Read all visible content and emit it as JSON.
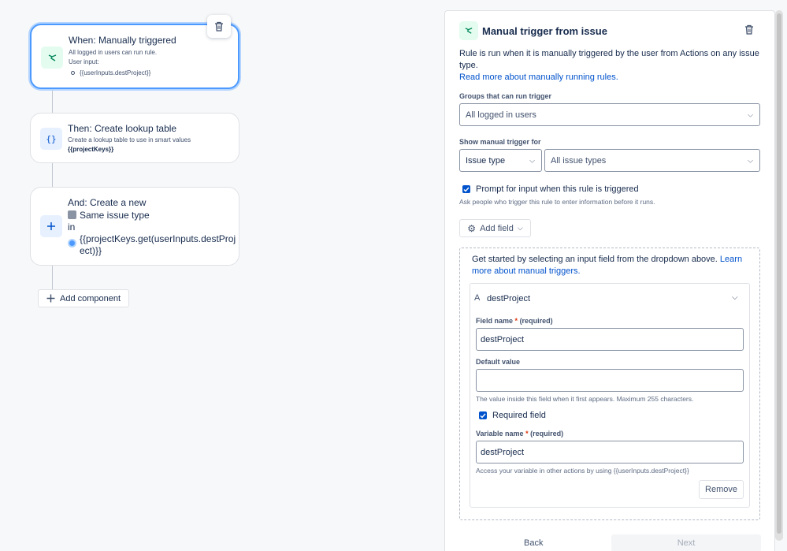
{
  "rule_canvas": {
    "trigger": {
      "title": "When: Manually triggered",
      "line1": "All logged in users can run rule.",
      "line2": "User input:",
      "input_item": "{{userInputs.destProject}}"
    },
    "lookup": {
      "title": "Then: Create lookup table",
      "line1": "Create a lookup table to use in smart values",
      "line2": "{{projectKeys}}"
    },
    "create": {
      "title": "And: Create a new",
      "issue_type": "Same issue type",
      "in_label": "in",
      "project_line1": "{{projectKeys.get(userInputs.destProj",
      "project_line2": "ect)}}"
    },
    "add_component_label": "Add component"
  },
  "panel": {
    "title": "Manual trigger from issue",
    "description": "Rule is run when it is manually triggered by the user from Actions on any issue type.",
    "read_more_link": "Read more about manually running rules.",
    "groups_label": "Groups that can run trigger",
    "groups_value": "All logged in users",
    "show_for_label": "Show manual trigger for",
    "show_for_type_value": "Issue type",
    "show_for_issue_types_value": "All issue types",
    "prompt_checkbox_label": "Prompt for input when this rule is triggered",
    "prompt_checked": true,
    "prompt_help": "Ask people who trigger this rule to enter information before it runs.",
    "add_field_label": "Add field",
    "get_started_text": "Get started by selecting an input field from the dropdown above.",
    "learn_more_link": "Learn more about manual triggers.",
    "field": {
      "header_name": "destProject",
      "field_name_label": "Field name",
      "required_suffix": "(required)",
      "field_name_value": "destProject",
      "default_value_label": "Default value",
      "default_value": "",
      "default_help": "The value inside this field when it first appears. Maximum 255 characters.",
      "required_label": "Required field",
      "required_checked": true,
      "variable_name_label": "Variable name",
      "variable_name_value": "destProject",
      "variable_help": "Access your variable in other actions by using {{userInputs.destProject}}",
      "remove_label": "Remove"
    },
    "back_label": "Back",
    "next_label": "Next"
  },
  "colors": {
    "accent": "#0052cc",
    "trigger_green": "#00875a",
    "selected_border": "#4c9aff"
  }
}
